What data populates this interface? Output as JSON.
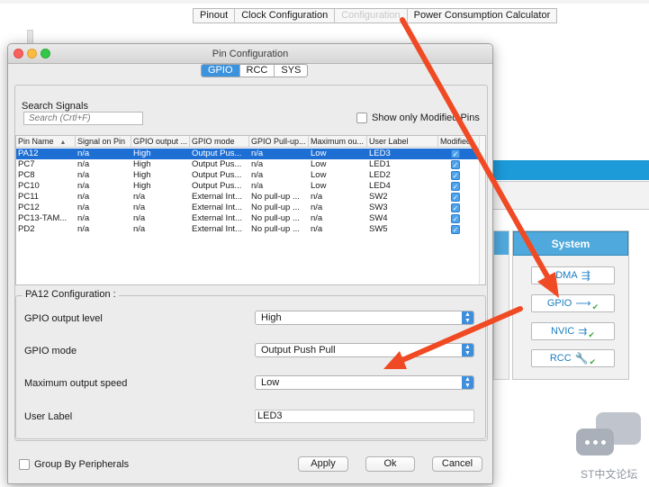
{
  "app": {
    "top_tabs": [
      "Pinout",
      "Clock Configuration",
      "Configuration",
      "Power Consumption Calculator"
    ]
  },
  "system_panel": {
    "title": "System",
    "buttons": [
      {
        "label": "DMA",
        "icon": "dma-icon"
      },
      {
        "label": "GPIO",
        "icon": "gpio-icon"
      },
      {
        "label": "NVIC",
        "icon": "nvic-icon"
      },
      {
        "label": "RCC",
        "icon": "rcc-icon"
      }
    ]
  },
  "dialog": {
    "title": "Pin Configuration",
    "tabs": [
      {
        "label": "GPIO",
        "active": true
      },
      {
        "label": "RCC",
        "active": false
      },
      {
        "label": "SYS",
        "active": false
      }
    ],
    "search": {
      "label": "Search Signals",
      "placeholder": "Search (Crtl+F)",
      "only_modified_label": "Show only Modified Pins"
    },
    "table": {
      "columns": [
        "Pin Name",
        "Signal on Pin",
        "GPIO output ...",
        "GPIO mode",
        "GPIO Pull-up...",
        "Maximum ou...",
        "User Label",
        "Modified"
      ],
      "rows": [
        {
          "pin": "PA12",
          "signal": "n/a",
          "output": "High",
          "mode": "Output Pus...",
          "pull": "n/a",
          "speed": "Low",
          "label": "LED3",
          "modified": true,
          "selected": true
        },
        {
          "pin": "PC7",
          "signal": "n/a",
          "output": "High",
          "mode": "Output Pus...",
          "pull": "n/a",
          "speed": "Low",
          "label": "LED1",
          "modified": true
        },
        {
          "pin": "PC8",
          "signal": "n/a",
          "output": "High",
          "mode": "Output Pus...",
          "pull": "n/a",
          "speed": "Low",
          "label": "LED2",
          "modified": true
        },
        {
          "pin": "PC10",
          "signal": "n/a",
          "output": "High",
          "mode": "Output Pus...",
          "pull": "n/a",
          "speed": "Low",
          "label": "LED4",
          "modified": true
        },
        {
          "pin": "PC11",
          "signal": "n/a",
          "output": "n/a",
          "mode": "External Int...",
          "pull": "No pull-up ...",
          "speed": "n/a",
          "label": "SW2",
          "modified": true
        },
        {
          "pin": "PC12",
          "signal": "n/a",
          "output": "n/a",
          "mode": "External Int...",
          "pull": "No pull-up ...",
          "speed": "n/a",
          "label": "SW3",
          "modified": true
        },
        {
          "pin": "PC13-TAM...",
          "signal": "n/a",
          "output": "n/a",
          "mode": "External Int...",
          "pull": "No pull-up ...",
          "speed": "n/a",
          "label": "SW4",
          "modified": true
        },
        {
          "pin": "PD2",
          "signal": "n/a",
          "output": "n/a",
          "mode": "External Int...",
          "pull": "No pull-up ...",
          "speed": "n/a",
          "label": "SW5",
          "modified": true
        }
      ]
    },
    "config": {
      "title": "PA12 Configuration :",
      "output_level_label": "GPIO output level",
      "output_level_value": "High",
      "mode_label": "GPIO mode",
      "mode_value": "Output Push Pull",
      "speed_label": "Maximum output speed",
      "speed_value": "Low",
      "user_label_label": "User Label",
      "user_label_value": "LED3"
    },
    "footer": {
      "group_by_label": "Group By Peripherals",
      "apply": "Apply",
      "ok": "Ok",
      "cancel": "Cancel"
    }
  },
  "watermark": {
    "text": "ST中文论坛"
  },
  "colors": {
    "accent": "#3b93dd",
    "selection": "#1e6fd4",
    "arrow": "#f04a24",
    "system_header": "#4fa9dc"
  }
}
